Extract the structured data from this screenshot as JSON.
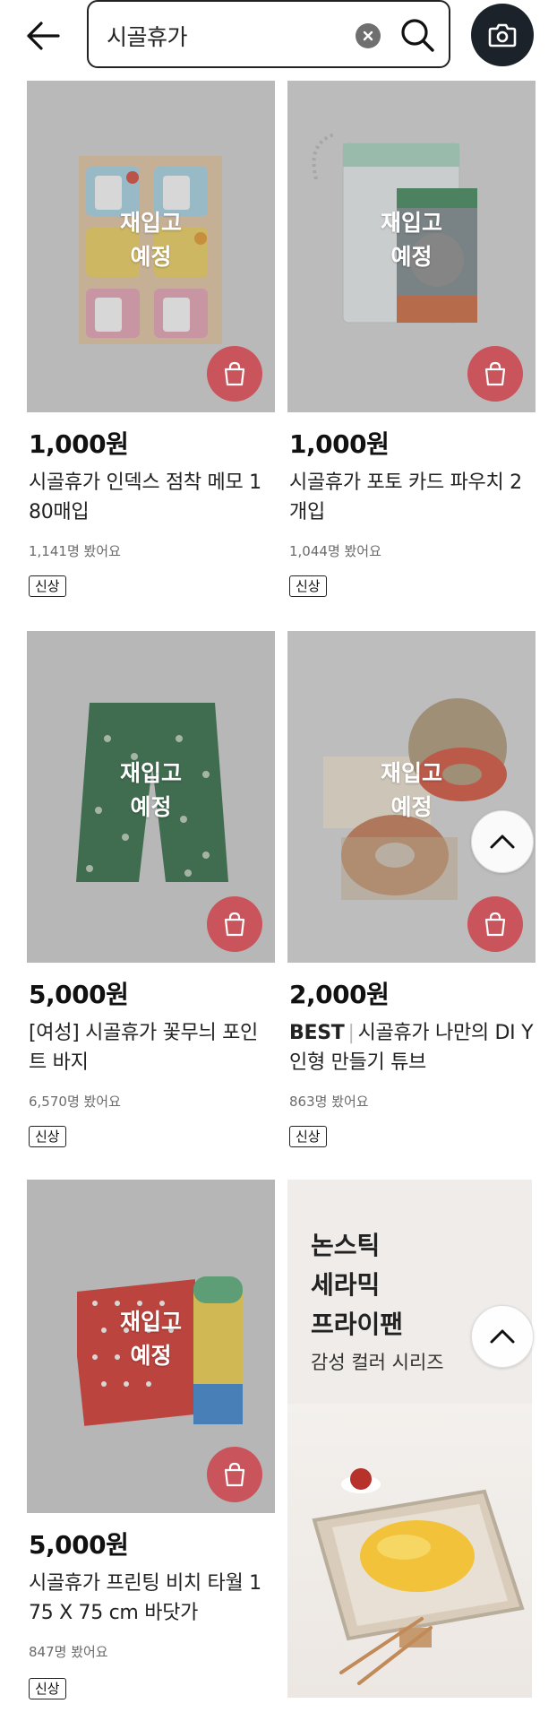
{
  "header": {
    "search_value": "시골휴가"
  },
  "restock_label": "재입고\n예정",
  "products": [
    {
      "price": "1,000원",
      "title": "시골휴가 인덱스 점착 메모 1 80매입",
      "views": "1,141명 봤어요",
      "badge": "신상"
    },
    {
      "price": "1,000원",
      "title": "시골휴가 포토 카드 파우치 2 개입",
      "views": "1,044명 봤어요",
      "badge": "신상"
    },
    {
      "price": "5,000원",
      "title": "[여성] 시골휴가 꽃무늬 포인 트 바지",
      "views": "6,570명 봤어요",
      "badge": "신상"
    },
    {
      "price": "2,000원",
      "best": "BEST",
      "title": "시골휴가 나만의 DI Y 인형 만들기 튜브",
      "views": "863명 봤어요",
      "badge": "신상"
    },
    {
      "price": "5,000원",
      "title": "시골휴가 프린팅 비치 타월 1 75 X 75 cm 바닷가",
      "views": "847명 봤어요",
      "badge": "신상"
    }
  ],
  "ad": {
    "title": "논스틱\n세라믹\n프라이팬",
    "subtitle": "감성 컬러 시리즈"
  },
  "colors": {
    "cart_button": "#c9545b",
    "camera_button": "#1b2229"
  }
}
